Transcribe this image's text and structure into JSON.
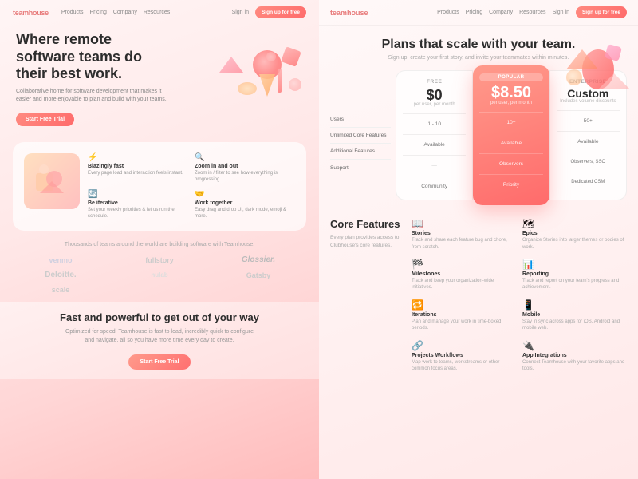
{
  "left": {
    "nav": {
      "logo": "teamhouse",
      "links": [
        "Products",
        "Pricing",
        "Company",
        "Resources"
      ],
      "signin": "Sign in",
      "cta": "Sign up for free"
    },
    "hero": {
      "title": "Where remote software teams do their best work.",
      "subtitle": "Collaborative home for software development that makes it easier and more enjoyable to plan and build with your teams.",
      "cta": "Start Free Trial"
    },
    "features": {
      "items": [
        {
          "icon": "⚡",
          "title": "Blazingly fast",
          "desc": "Every page load and interaction feels instant."
        },
        {
          "icon": "🔍",
          "title": "Zoom in and out",
          "desc": "Zoom in / filter to see how everything is progressing."
        },
        {
          "icon": "🔄",
          "title": "Be iterative",
          "desc": "Set your weekly priorities & let us run the schedule."
        },
        {
          "icon": "🤝",
          "title": "Work together",
          "desc": "Easy drag and drop UI, dark mode, emoji & more."
        }
      ]
    },
    "logos": {
      "title": "Thousands of teams around the world are building software with Teamhouse.",
      "items": [
        "venmo",
        "fullstory",
        "Glossier.",
        "Deloitte.",
        "nulab",
        "Gatsby",
        "scale"
      ]
    },
    "cta_section": {
      "title": "Fast and powerful to get out of your way",
      "subtitle": "Optimized for speed, Teamhouse is fast to load, incredibly quick to configure and navigate, all so you have more time every day to create.",
      "cta": "Start Free Trial"
    }
  },
  "right": {
    "nav": {
      "logo": "teamhouse",
      "links": [
        "Products",
        "Pricing",
        "Company",
        "Resources"
      ],
      "signin": "Sign in",
      "cta": "Sign up for free"
    },
    "pricing": {
      "title": "Plans that scale with your team.",
      "subtitle": "Sign up, create your first story, and invite your teammates within minutes.",
      "plans": [
        {
          "id": "free",
          "label": "FREE",
          "price": "$0",
          "per": "per user, per month",
          "users": "1 - 10",
          "unlimited_core": "Available",
          "additional": "—",
          "support": "Community"
        },
        {
          "id": "popular",
          "label": "POPULAR",
          "badge": "POPULAR",
          "price": "$8.50",
          "per": "per user, per month",
          "users": "10+",
          "unlimited_core": "Available",
          "additional": "Observers",
          "support": "Priority"
        },
        {
          "id": "enterprise",
          "label": "ENTERPRISE",
          "price": "Custom",
          "per": "Includes volume discounts",
          "users": "50+",
          "unlimited_core": "Available",
          "additional": "Observers, SSO",
          "support": "Dedicated CSM"
        }
      ],
      "row_labels": [
        "Users",
        "Unlimited Core Features",
        "Additional Features",
        "Support"
      ]
    },
    "core_features": {
      "title": "Core Features",
      "subtitle": "Every plan provides access to Clubhouse's core features.",
      "features": [
        {
          "icon": "📖",
          "name": "Stories",
          "desc": "Track and share each feature bug and chore, from scratch."
        },
        {
          "icon": "🗺",
          "name": "Epics",
          "desc": "Organize Stories into larger themes or bodies of work."
        },
        {
          "icon": "🏁",
          "name": "Milestones",
          "desc": "Track and keep your organization-wide initiatives."
        },
        {
          "icon": "📊",
          "name": "Reporting",
          "desc": "Track and report on your team's progress and achievement."
        },
        {
          "icon": "🔁",
          "name": "Iterations",
          "desc": "Plan and manage your work in time-boxed periods."
        },
        {
          "icon": "📱",
          "name": "Mobile",
          "desc": "Stay in sync across apps for iOS, Android and mobile web."
        },
        {
          "icon": "🔗",
          "name": "Projects Workflows",
          "desc": "Map work to teams, workstreams or other common focus areas."
        },
        {
          "icon": "🔌",
          "name": "App Integrations",
          "desc": "Connect Teamhouse with your favorite apps and tools."
        }
      ]
    }
  }
}
